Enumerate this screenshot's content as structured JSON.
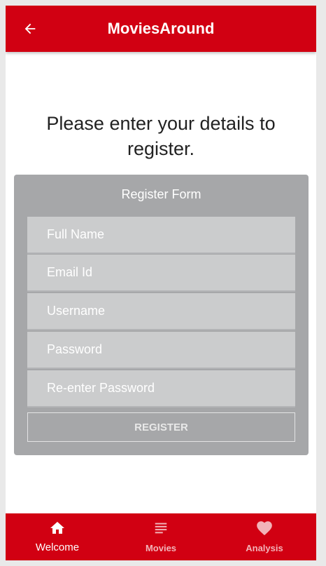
{
  "app": {
    "title": "MoviesAround",
    "back_icon": "arrow-left-icon"
  },
  "colors": {
    "brand": "#d10012",
    "card": "#a6a7a9",
    "field": "#cbcccd"
  },
  "main": {
    "prompt": "Please enter your details to register."
  },
  "form": {
    "title": "Register Form",
    "fields": [
      {
        "placeholder": "Full Name"
      },
      {
        "placeholder": "Email Id"
      },
      {
        "placeholder": "Username"
      },
      {
        "placeholder": "Password"
      },
      {
        "placeholder": "Re-enter Password"
      }
    ],
    "submit_label": "REGISTER"
  },
  "bottom_nav": {
    "items": [
      {
        "label": "Welcome",
        "icon": "home-icon",
        "active": true
      },
      {
        "label": "Movies",
        "icon": "list-icon",
        "active": false
      },
      {
        "label": "Analysis",
        "icon": "heart-icon",
        "active": false
      }
    ]
  }
}
